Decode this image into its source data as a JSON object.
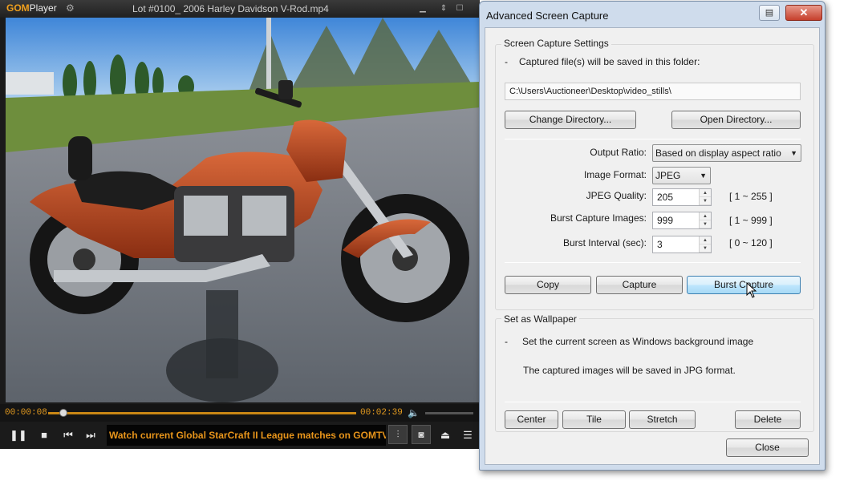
{
  "player": {
    "logo_gom": "GOM",
    "logo_player": "Player",
    "title": "Lot #0100_ 2006 Harley Davidson V-Rod.mp4",
    "time_current": "00:00:08",
    "time_total": "00:02:39",
    "progress_fraction": 0.05,
    "ticker": "Watch current Global StarCraft II League matches on GOMTV"
  },
  "dialog": {
    "title": "Advanced Screen Capture",
    "settings_group": "Screen Capture Settings",
    "bullet": "-",
    "save_note": "Captured file(s) will be saved in this folder:",
    "path": "C:\\Users\\Auctioneer\\Desktop\\video_stills\\",
    "change_dir": "Change Directory...",
    "open_dir": "Open Directory...",
    "output_ratio_label": "Output Ratio:",
    "output_ratio_value": "Based on display aspect ratio",
    "image_format_label": "Image Format:",
    "image_format_value": "JPEG",
    "jpeg_quality_label": "JPEG Quality:",
    "jpeg_quality_value": "205",
    "jpeg_quality_range": "[ 1 ~ 255 ]",
    "burst_images_label": "Burst Capture Images:",
    "burst_images_value": "999",
    "burst_images_range": "[ 1 ~ 999 ]",
    "burst_interval_label": "Burst Interval (sec):",
    "burst_interval_value": "3",
    "burst_interval_range": "[ 0 ~ 120 ]",
    "copy": "Copy",
    "capture": "Capture",
    "burst_capture": "Burst Capture",
    "wallpaper_group": "Set as Wallpaper",
    "wallpaper_note1": "Set the current screen as Windows background image",
    "wallpaper_note2": "The captured images will be saved in JPG format.",
    "center": "Center",
    "tile": "Tile",
    "stretch": "Stretch",
    "delete": "Delete",
    "close": "Close"
  }
}
